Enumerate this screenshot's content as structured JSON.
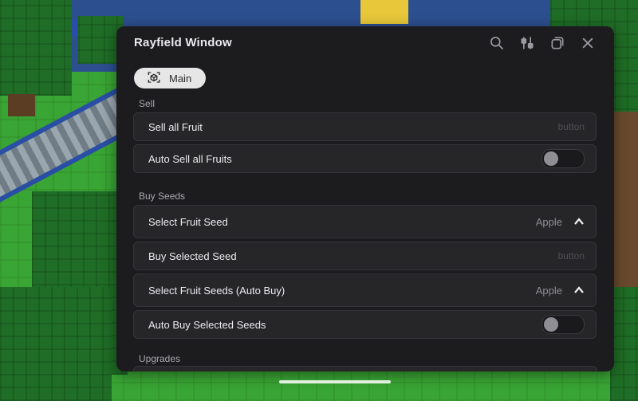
{
  "window": {
    "title": "Rayfield Window",
    "icons": [
      "search-icon",
      "settings-sliders-icon",
      "minimize-icon",
      "close-icon"
    ]
  },
  "tabs": [
    {
      "label": "Main",
      "icon": "cube-scan-icon"
    }
  ],
  "sections": {
    "sell": {
      "label": "Sell",
      "sell_all_fruit": {
        "label": "Sell all Fruit",
        "hint": "button"
      },
      "auto_sell": {
        "label": "Auto Sell all Fruits",
        "enabled": false
      }
    },
    "buy_seeds": {
      "label": "Buy Seeds",
      "select_fruit_seed": {
        "label": "Select Fruit Seed",
        "value": "Apple"
      },
      "buy_selected_seed": {
        "label": "Buy Selected Seed",
        "hint": "button"
      },
      "select_fruit_seeds_auto": {
        "label": "Select Fruit Seeds (Auto Buy)",
        "value": "Apple"
      },
      "auto_buy": {
        "label": "Auto Buy Selected Seeds",
        "enabled": false
      }
    },
    "upgrades": {
      "label": "Upgrades"
    }
  },
  "colors": {
    "window_bg": "#1c1c1f",
    "row_bg": "#262629",
    "tab_bg": "#e6e6e6",
    "text": "#ececf0",
    "muted": "#8e8e94"
  }
}
